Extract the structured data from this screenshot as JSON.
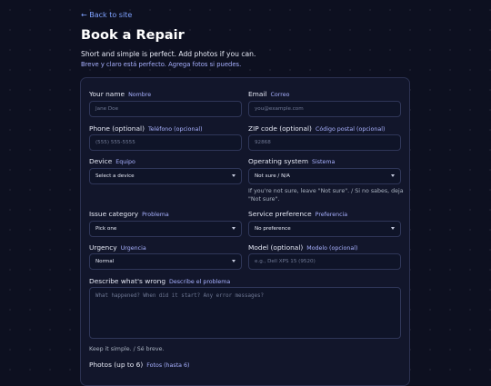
{
  "nav": {
    "back_label": "← Back to site"
  },
  "page": {
    "title": "Book a Repair",
    "subtitle_en": "Short and simple is perfect. Add photos if you can.",
    "subtitle_es": "Breve y claro está perfecto. Agrega fotos si puedes."
  },
  "form": {
    "name": {
      "label": "Your name",
      "label_es": "Nombre",
      "placeholder": "Jane Doe"
    },
    "email": {
      "label": "Email",
      "label_es": "Correo",
      "placeholder": "you@example.com"
    },
    "phone": {
      "label": "Phone (optional)",
      "label_es": "Teléfono (opcional)",
      "placeholder": "(555) 555-5555"
    },
    "zip": {
      "label": "ZIP code (optional)",
      "label_es": "Código postal (opcional)",
      "placeholder": "92868"
    },
    "device": {
      "label": "Device",
      "label_es": "Equipo",
      "value": "Select a device"
    },
    "os": {
      "label": "Operating system",
      "label_es": "Sistema",
      "value": "Not sure / N/A",
      "hint_line1": "If you're not sure, leave \"Not sure\". / Si no sabes, deja",
      "hint_line2": "\"Not sure\"."
    },
    "issue": {
      "label": "Issue category",
      "label_es": "Problema",
      "value": "Pick one"
    },
    "service": {
      "label": "Service preference",
      "label_es": "Preferencia",
      "value": "No preference"
    },
    "urgency": {
      "label": "Urgency",
      "label_es": "Urgencia",
      "value": "Normal"
    },
    "model": {
      "label": "Model (optional)",
      "label_es": "Modelo (opcional)",
      "placeholder": "e.g., Dell XPS 15 (9520)"
    },
    "describe": {
      "label": "Describe what's wrong",
      "label_es": "Describe el problema",
      "placeholder": "What happened? When did it start? Any error messages?",
      "hint": "Keep it simple. / Sé breve."
    },
    "photos": {
      "label": "Photos (up to 6)",
      "label_es": "Fotos (hasta 6)"
    }
  },
  "colors": {
    "background": "#0d1020",
    "card": "#12162b",
    "link": "#7fa2ff",
    "accent_text": "#a8b1ff"
  }
}
